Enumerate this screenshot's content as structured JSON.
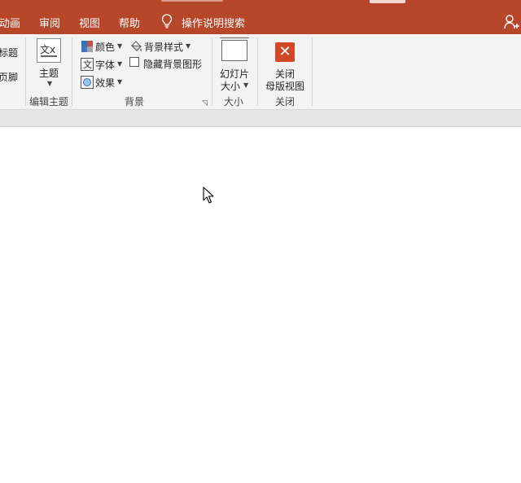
{
  "tabs": [
    {
      "id": "animation",
      "label": "动画"
    },
    {
      "id": "review",
      "label": "审阅"
    },
    {
      "id": "view",
      "label": "视图"
    },
    {
      "id": "help",
      "label": "帮助"
    }
  ],
  "tell_me": {
    "label": "操作说明搜索",
    "icon": "lightbulb-icon"
  },
  "ribbon": {
    "left_partial": {
      "title": "标题",
      "footer": "页脚"
    },
    "edit_theme": {
      "theme_button": "主题",
      "theme_icon_text": "文x",
      "group_label": "编辑主题"
    },
    "background": {
      "colors": "颜色",
      "fonts": "字体",
      "effects": "效果",
      "bg_styles": "背景样式",
      "hide_bg_graphics": "隐藏背景图形",
      "hide_bg_graphics_checked": false,
      "group_label": "背景"
    },
    "size": {
      "slide_size_line1": "幻灯片",
      "slide_size_line2": "大小",
      "group_label": "大小"
    },
    "close": {
      "close_line1": "关闭",
      "close_line2": "母版视图",
      "group_label": "关闭",
      "icon_glyph": "✕"
    }
  },
  "colors": {
    "accent": "#b7472a",
    "close_red": "#d24726",
    "ribbon_bg": "#f3f3f3"
  }
}
